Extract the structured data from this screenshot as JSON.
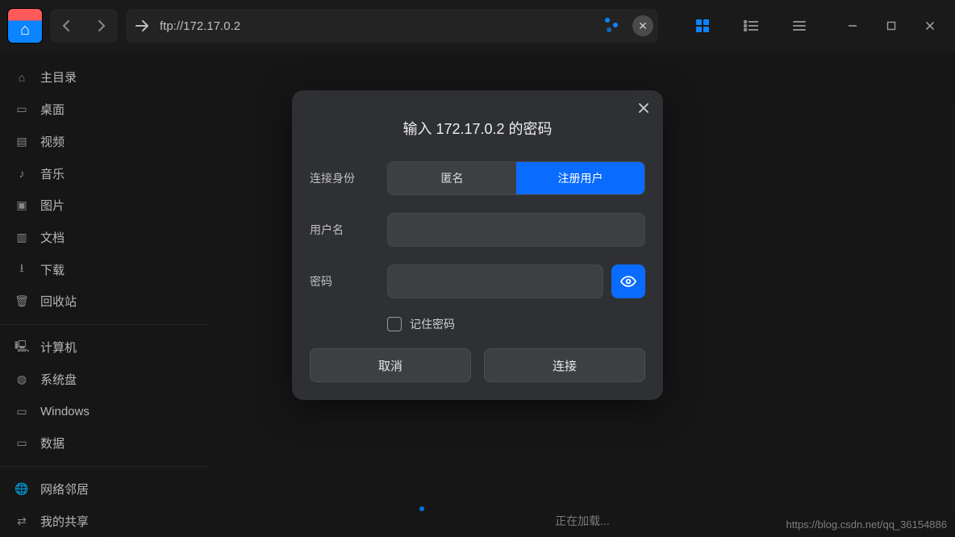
{
  "titlebar": {
    "address": "ftp://172.17.0.2"
  },
  "sidebar": {
    "groups": [
      [
        {
          "icon": "home",
          "label": "主目录"
        },
        {
          "icon": "desktop",
          "label": "桌面"
        },
        {
          "icon": "video",
          "label": "视频"
        },
        {
          "icon": "music",
          "label": "音乐"
        },
        {
          "icon": "picture",
          "label": "图片"
        },
        {
          "icon": "doc",
          "label": "文档"
        },
        {
          "icon": "download",
          "label": "下载"
        },
        {
          "icon": "trash",
          "label": "回收站"
        }
      ],
      [
        {
          "icon": "computer",
          "label": "计算机"
        },
        {
          "icon": "sysdisk",
          "label": "系统盘"
        },
        {
          "icon": "disk",
          "label": "Windows"
        },
        {
          "icon": "disk",
          "label": "数据"
        }
      ],
      [
        {
          "icon": "network",
          "label": "网络邻居"
        },
        {
          "icon": "share",
          "label": "我的共享"
        }
      ]
    ]
  },
  "main": {
    "loading": "正在加载..."
  },
  "modal": {
    "title": "输入 172.17.0.2 的密码",
    "identity_label": "连接身份",
    "identity_anonymous": "匿名",
    "identity_registered": "注册用户",
    "username_label": "用户名",
    "username_value": "",
    "password_label": "密码",
    "password_value": "",
    "remember_label": "记住密码",
    "cancel": "取消",
    "connect": "连接"
  },
  "watermark": "https://blog.csdn.net/qq_36154886"
}
